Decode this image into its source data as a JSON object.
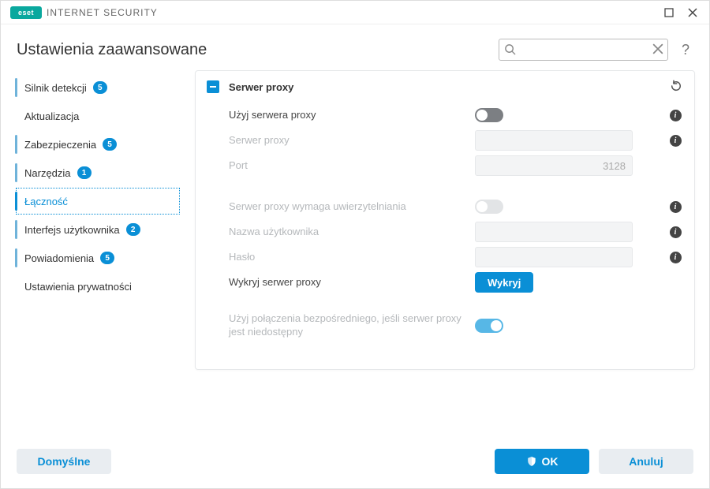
{
  "app": {
    "brand_mark": "eset",
    "product": "INTERNET SECURITY"
  },
  "header": {
    "title": "Ustawienia zaawansowane",
    "search_placeholder": "",
    "help_glyph": "?"
  },
  "sidebar": {
    "items": [
      {
        "label": "Silnik detekcji",
        "badge": "5"
      },
      {
        "label": "Aktualizacja"
      },
      {
        "label": "Zabezpieczenia",
        "badge": "5"
      },
      {
        "label": "Narzędzia",
        "badge": "1"
      },
      {
        "label": "Łączność",
        "active": true
      },
      {
        "label": "Interfejs użytkownika",
        "badge": "2"
      },
      {
        "label": "Powiadomienia",
        "badge": "5"
      },
      {
        "label": "Ustawienia prywatności"
      }
    ]
  },
  "panel": {
    "section_title": "Serwer proxy",
    "rows": {
      "use_proxy": {
        "label": "Użyj serwera proxy",
        "value": false
      },
      "proxy_server": {
        "label": "Serwer proxy",
        "value": ""
      },
      "port": {
        "label": "Port",
        "value": "3128"
      },
      "auth": {
        "label": "Serwer proxy wymaga uwierzytelniania",
        "value": false
      },
      "username": {
        "label": "Nazwa użytkownika",
        "value": ""
      },
      "password": {
        "label": "Hasło",
        "value": ""
      },
      "detect": {
        "label": "Wykryj serwer proxy",
        "button": "Wykryj"
      },
      "direct": {
        "label": "Użyj połączenia bezpośredniego, jeśli serwer proxy jest niedostępny",
        "value": true
      }
    }
  },
  "footer": {
    "defaults": "Domyślne",
    "ok": "OK",
    "cancel": "Anuluj"
  }
}
